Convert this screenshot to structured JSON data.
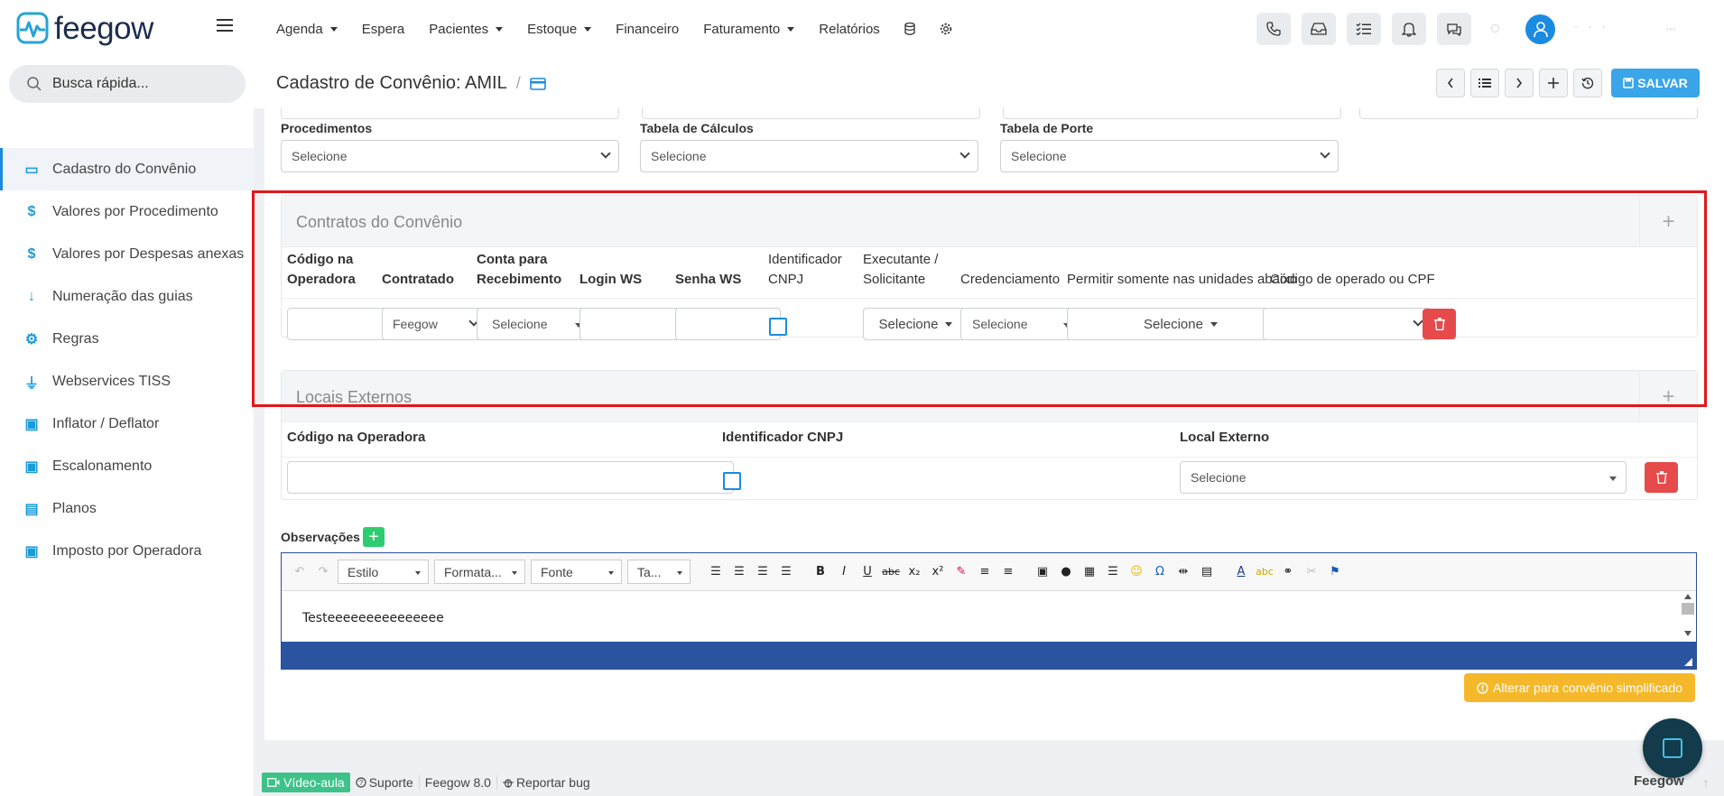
{
  "app": {
    "name": "feegow"
  },
  "nav": {
    "items": [
      {
        "label": "Agenda",
        "caret": true
      },
      {
        "label": "Espera",
        "caret": false
      },
      {
        "label": "Pacientes",
        "caret": true
      },
      {
        "label": "Estoque",
        "caret": true
      },
      {
        "label": "Financeiro",
        "caret": false
      },
      {
        "label": "Faturamento",
        "caret": true
      },
      {
        "label": "Relatórios",
        "caret": false
      }
    ]
  },
  "user": {
    "name_masked": "· · ·",
    "extra_masked": "..."
  },
  "search": {
    "placeholder": "Busca rápida..."
  },
  "sidebar": {
    "items": [
      {
        "label": "Cadastro do Convênio",
        "icon": "card-icon",
        "active": true
      },
      {
        "label": "Valores por Procedimento",
        "icon": "dollar-icon"
      },
      {
        "label": "Valores por Despesas anexas",
        "icon": "dollar-icon"
      },
      {
        "label": "Numeração das guias",
        "icon": "sort-numeric-icon"
      },
      {
        "label": "Regras",
        "icon": "gears-icon"
      },
      {
        "label": "Webservices TISS",
        "icon": "plug-icon"
      },
      {
        "label": "Inflator / Deflator",
        "icon": "money-icon"
      },
      {
        "label": "Escalonamento",
        "icon": "money-icon"
      },
      {
        "label": "Planos",
        "icon": "list-icon"
      },
      {
        "label": "Imposto por Operadora",
        "icon": "money-icon"
      }
    ]
  },
  "page": {
    "title": "Cadastro de Convênio: AMIL",
    "save_label": "SALVAR"
  },
  "form": {
    "procedimentos": {
      "label": "Procedimentos",
      "value": "Selecione"
    },
    "tabela_calculos": {
      "label": "Tabela de Cálculos",
      "value": "Selecione"
    },
    "tabela_porte": {
      "label": "Tabela de Porte",
      "value": "Selecione"
    }
  },
  "contratos": {
    "title": "Contratos do Convênio",
    "headers": {
      "codigo": {
        "l1": "Código na",
        "l2": "Operadora"
      },
      "contratado": "Contratado",
      "conta": {
        "l1": "Conta para",
        "l2": "Recebimento"
      },
      "login": "Login WS",
      "senha": "Senha WS",
      "cnpj": {
        "l1": "Identificador",
        "l2": "CNPJ"
      },
      "executante": {
        "l1": "Executante /",
        "l2": "Solicitante"
      },
      "credenciamento": "Credenciamento",
      "permitir": "Permitir somente nas unidades abaixo",
      "codigo_cpf": "Código de operado ou CPF"
    },
    "row": {
      "contratado": "Feegow",
      "conta": "Selecione",
      "executante": "Selecione",
      "credenciamento": "Selecione",
      "permitir": "Selecione"
    }
  },
  "locais": {
    "title": "Locais Externos",
    "headers": {
      "codigo": "Código na Operadora",
      "cnpj": "Identificador CNPJ",
      "local": "Local Externo"
    },
    "row": {
      "local": "Selecione"
    }
  },
  "observacoes": {
    "label": "Observações",
    "toolbar": {
      "estilo": "Estilo",
      "formatacao": "Formata...",
      "fonte": "Fonte",
      "tamanho": "Ta..."
    },
    "content": "Testeeeeeeeeeeeeeee"
  },
  "simplify_label": "Alterar para convênio simplificado",
  "footer": {
    "video": "Vídeo-aula",
    "support": "Suporte",
    "version": "Feegow 8.0",
    "bug": "Reportar bug",
    "brand": "Feegow"
  },
  "colors": {
    "primary": "#1a8be0",
    "save": "#3aa5e8",
    "danger": "#e64a4a",
    "warning": "#f5b82a",
    "highlight": "#e3161b",
    "editor_status": "#2b54a0"
  }
}
